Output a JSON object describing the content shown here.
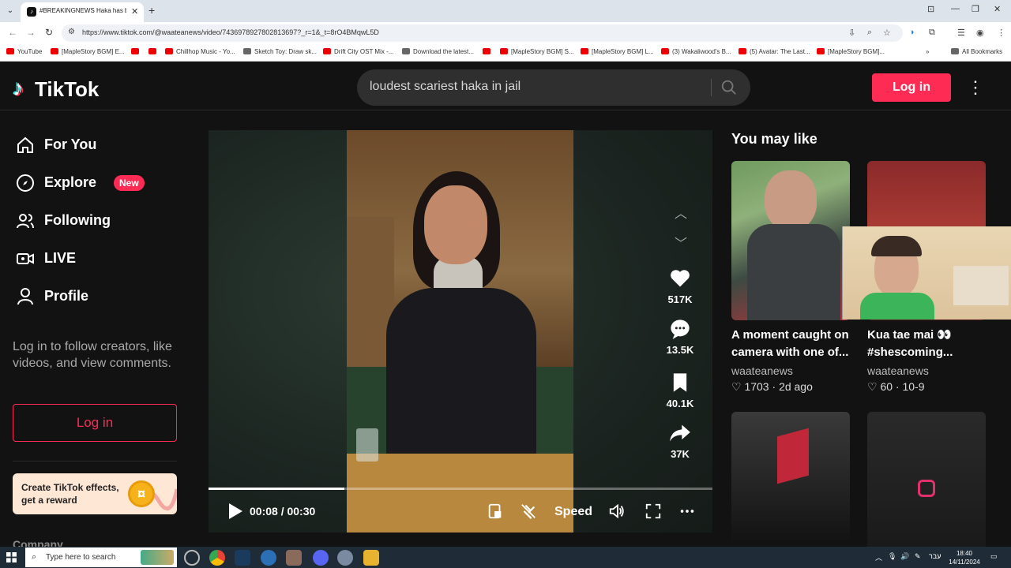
{
  "browser": {
    "tab_title": "#BREAKINGNEWS Haka has bro",
    "url": "https://www.tiktok.com/@waateanews/video/7436978927802813697?_r=1&_t=8rO4BMqwL5D",
    "bookmarks": [
      "YouTube",
      "[MapleStory BGM] E...",
      "",
      "",
      "Chillhop Music - Yo...",
      "Sketch Toy: Draw sk...",
      "Drift City OST Mix -...",
      "Download the latest...",
      "",
      "[MapleStory BGM] S...",
      "[MapleStory BGM] L...",
      "(3) Wakaliwood's B...",
      "(5) Avatar: The Last...",
      "[MapleStory BGM]..."
    ],
    "all_bookmarks": "All Bookmarks"
  },
  "header": {
    "logo": "TikTok",
    "search_value": "loudest scariest haka in jail",
    "login": "Log in"
  },
  "sidebar": {
    "items": [
      {
        "label": "For You",
        "icon": "home-icon"
      },
      {
        "label": "Explore",
        "icon": "compass-icon",
        "badge": "New"
      },
      {
        "label": "Following",
        "icon": "people-icon"
      },
      {
        "label": "LIVE",
        "icon": "live-icon"
      },
      {
        "label": "Profile",
        "icon": "person-icon"
      }
    ],
    "description": "Log in to follow creators, like videos, and view comments.",
    "login": "Log in",
    "effects": "Create TikTok effects, get a reward",
    "company": "Company"
  },
  "video": {
    "likes": "517K",
    "comments": "13.5K",
    "saves": "40.1K",
    "shares": "37K",
    "time": "00:08 / 00:30",
    "progress": 0.27,
    "speed": "Speed"
  },
  "recommendations": {
    "title": "You may like",
    "cards": [
      {
        "title": "A moment caught on camera with one of...",
        "author": "waateanews",
        "likes": "1703",
        "age": "2d ago"
      },
      {
        "title": "Kua tae mai 👀 #shescoming...",
        "author": "waateanews",
        "likes": "60",
        "age": "10-9"
      }
    ]
  },
  "taskbar": {
    "search_placeholder": "Type here to search",
    "lang": "עבר",
    "time": "18:40",
    "date": "14/11/2024"
  },
  "colors": {
    "accent": "#fe2c55",
    "bg": "#121212"
  }
}
